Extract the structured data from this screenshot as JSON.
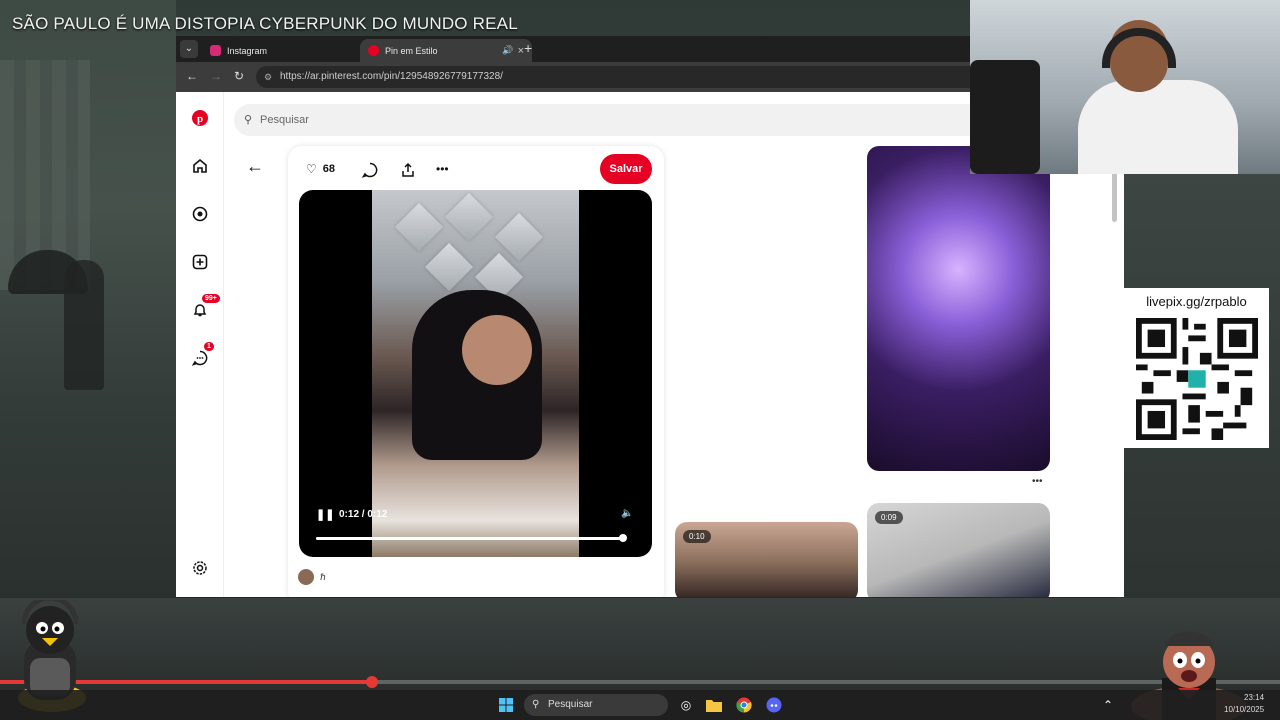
{
  "stream": {
    "title": "SÃO PAULO É UMA DISTOPIA CYBERPUNK DO MUNDO REAL",
    "seek_progress": 0.291
  },
  "browser": {
    "tabs": [
      {
        "label": "Instagram",
        "close": "×",
        "color": "#d62976"
      },
      {
        "label": "Pin em Estilo",
        "close": "×",
        "color": "#e60023",
        "audio": "🔊"
      }
    ],
    "new_tab": "+",
    "url": "https://ar.pinterest.com/pin/129548926779177328/"
  },
  "pinterest": {
    "search_placeholder": "Pesquisar",
    "notifications_badge": "99+",
    "messages_badge": "1",
    "likes": "68",
    "save_label": "Salvar",
    "video": {
      "time": "0:12 / 0:12",
      "progress": 0.99
    },
    "creator_name": "ℏ",
    "grid": [
      {
        "duration": "0:10"
      },
      {
        "duration": "0:09"
      }
    ],
    "accent": "#e60023"
  },
  "overlay": {
    "qr_label": "livepix.gg/zrpablo"
  },
  "taskbar": {
    "search_placeholder": "Pesquisar",
    "time": "23:14",
    "date": "10/10/2025"
  }
}
